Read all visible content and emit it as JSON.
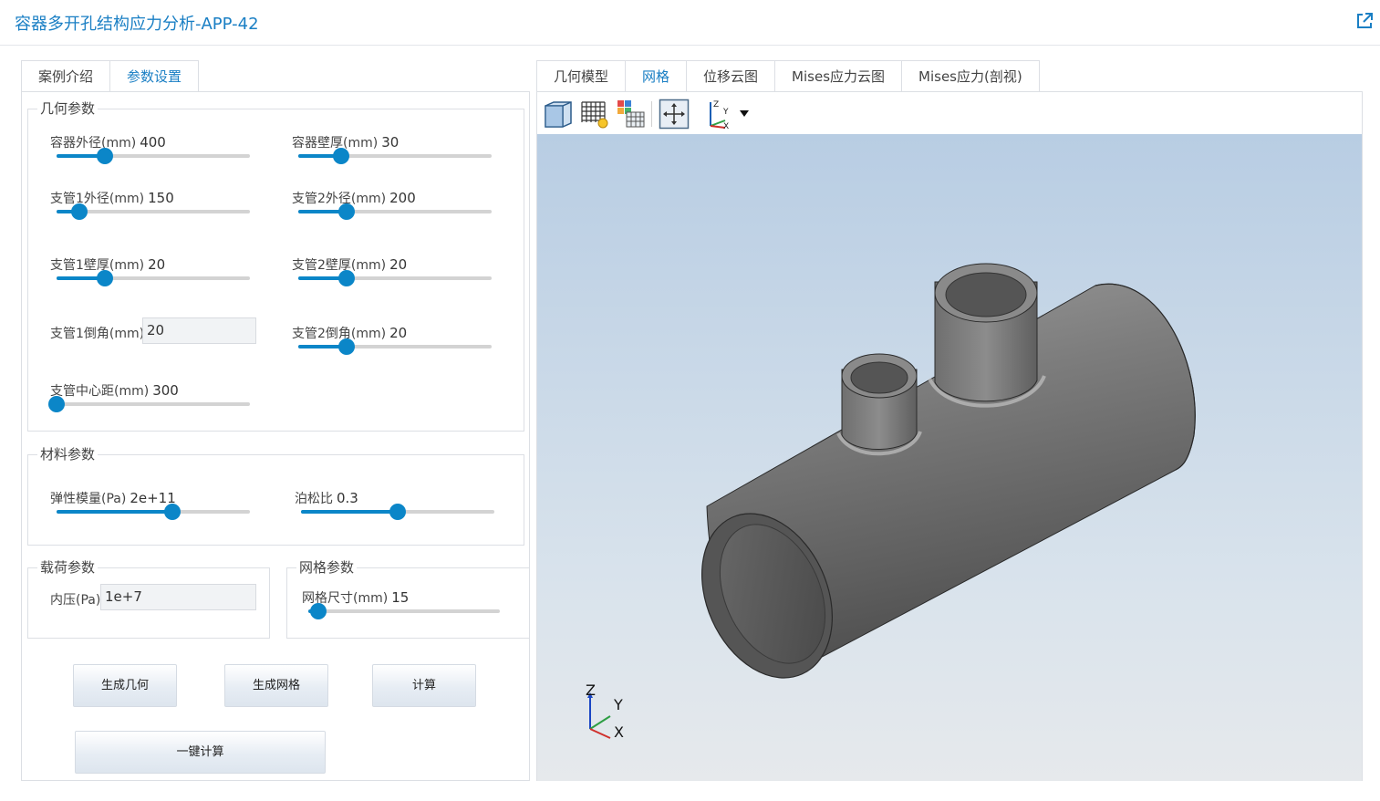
{
  "app": {
    "title": "容器多开孔结构应力分析-APP-42"
  },
  "left_tabs": [
    "案例介绍",
    "参数设置"
  ],
  "groups": {
    "geometry": "几何参数",
    "material": "材料参数",
    "load": "载荷参数",
    "mesh": "网格参数"
  },
  "params": {
    "vessel_od": {
      "label": "容器外径(mm)",
      "value": "400",
      "fraction": 0.25
    },
    "vessel_t": {
      "label": "容器壁厚(mm)",
      "value": "30",
      "fraction": 0.22
    },
    "branch1_od": {
      "label": "支管1外径(mm)",
      "value": "150",
      "fraction": 0.12
    },
    "branch2_od": {
      "label": "支管2外径(mm)",
      "value": "200",
      "fraction": 0.25
    },
    "branch1_t": {
      "label": "支管1壁厚(mm)",
      "value": "20",
      "fraction": 0.25
    },
    "branch2_t": {
      "label": "支管2壁厚(mm)",
      "value": "20",
      "fraction": 0.25
    },
    "branch1_fillet": {
      "label": "支管1倒角(mm)",
      "value": "20"
    },
    "branch2_fillet": {
      "label": "支管2倒角(mm)",
      "value": "20",
      "fraction": 0.25
    },
    "branch_spacing": {
      "label": "支管中心距(mm)",
      "value": "300",
      "fraction": 0.0
    },
    "youngs": {
      "label": "弹性模量(Pa)",
      "value": "2e+11",
      "fraction": 0.6
    },
    "poisson": {
      "label": "泊松比",
      "value": "0.3",
      "fraction": 0.5
    },
    "pressure": {
      "label": "内压(Pa)",
      "value": "1e+7"
    },
    "mesh_size": {
      "label": "网格尺寸(mm)",
      "value": "15",
      "fraction": 0.05
    }
  },
  "buttons": {
    "gen_geometry": "生成几何",
    "gen_mesh": "生成网格",
    "compute": "计算",
    "one_click": "一键计算"
  },
  "right_tabs": [
    "几何模型",
    "网格",
    "位移云图",
    "Mises应力云图",
    "Mises应力(剖视)"
  ],
  "active_right_tab": 1,
  "triad": {
    "z": "Z",
    "y": "Y",
    "x": "X"
  },
  "colors": {
    "accent": "#0b86c8",
    "title": "#1a7fc4"
  }
}
